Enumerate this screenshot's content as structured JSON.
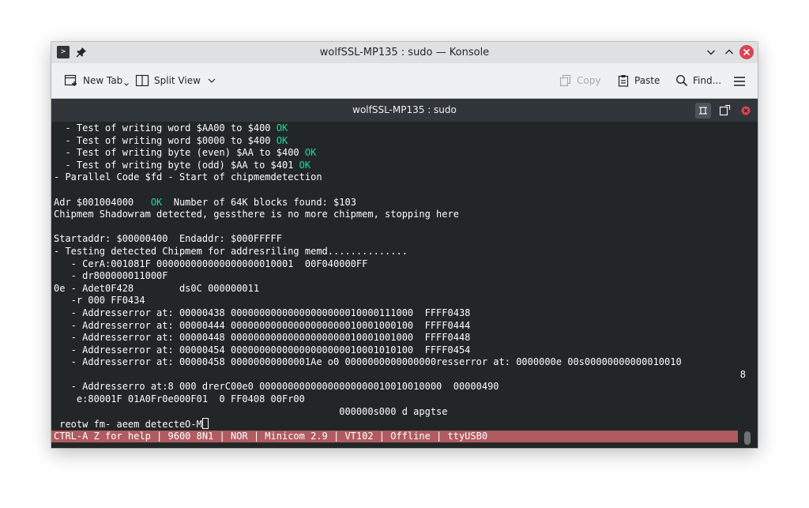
{
  "window": {
    "title": "wolfSSL-MP135 : sudo — Konsole"
  },
  "toolbar": {
    "new_tab": "New Tab",
    "split_view": "Split View",
    "copy": "Copy",
    "paste": "Paste",
    "find": "Find..."
  },
  "tab": {
    "title": "wolfSSL-MP135 : sudo"
  },
  "terminal": {
    "lines": [
      {
        "text": "  - Test of writing word $AA00 to $400 ",
        "ok": "OK"
      },
      {
        "text": "  - Test of writing word $0000 to $400 ",
        "ok": "OK"
      },
      {
        "text": "  - Test of writing byte (even) $AA to $400 ",
        "ok": "OK"
      },
      {
        "text": "  - Test of writing byte (odd) $AA to $401 ",
        "ok": "OK"
      },
      {
        "text": "- Parallel Code $fd - Start of chipmemdetection",
        "ok": ""
      },
      {
        "text": "",
        "ok": ""
      },
      {
        "text": "Adr $001004000   ",
        "ok": "OK",
        "after": "  Number of 64K blocks found: $103"
      },
      {
        "text": "Chipmem Shadowram detected, gessthere is no more chipmem, stopping here",
        "ok": ""
      },
      {
        "text": "",
        "ok": ""
      },
      {
        "text": "Startaddr: $00000400  Endaddr: $000FFFFF",
        "ok": ""
      },
      {
        "text": "- Testing detected Chipmem for addresriling memd..............",
        "ok": ""
      },
      {
        "text": "   - CerA:001081F 000000000000000000010001  00F040000FF",
        "ok": ""
      },
      {
        "text": "   - dr800000011000F",
        "ok": ""
      },
      {
        "text": "0e - Adet0F428        ds0C 000000011",
        "ok": ""
      },
      {
        "text": "   -r 000 FF0434",
        "ok": ""
      },
      {
        "text": "   - Addresserror at: 00000438 00000000000000000000010000111000  FFFF0438",
        "ok": ""
      },
      {
        "text": "   - Addresserror at: 00000444 00000000000000000000010001000100  FFFF0444",
        "ok": ""
      },
      {
        "text": "   - Addresserror at: 00000448 00000000000000000000010001001000  FFFF0448",
        "ok": ""
      },
      {
        "text": "   - Addresserror at: 00000454 00000000000000000000010001010100  FFFF0454",
        "ok": ""
      },
      {
        "text": "   - Addresserror at: 00000458 00000000000001Ae o0 0000000000000000resserror at: 0000000e 00s00000000000010010",
        "ok": ""
      },
      {
        "text": "8",
        "ok": "",
        "align": "right"
      },
      {
        "text": "   - Addresserro at:8 000 drerC00e0 00000000000000000000010010010000  00000490",
        "ok": ""
      },
      {
        "text": "    e:80001F 01A0Fr0e000F01  0 FF0408 00Fr00",
        "ok": ""
      },
      {
        "text": "                                                  000000s000 d apgtse",
        "ok": ""
      },
      {
        "text": " reotw fm- aeem detecteO-M",
        "ok": "",
        "cursor": true
      },
      {
        "text": "CTRL-A Z for help | 9600 8N1 | NOR | Minicom 2.9 | VT102 | Offline | ttyUSB0",
        "ok": "",
        "status": true
      }
    ]
  },
  "colors": {
    "terminal_bg": "#232627",
    "terminal_fg": "#fcfcfc",
    "ok_green": "#1cdc9a",
    "statusline_bg": "#b05b61",
    "close_red": "#da4453"
  }
}
